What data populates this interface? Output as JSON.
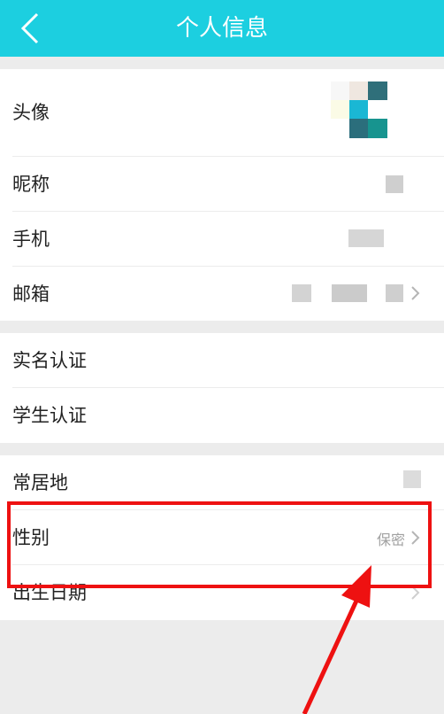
{
  "header": {
    "title": "个人信息",
    "back_icon": "chevron-left-icon",
    "bg_color": "#1ccfe0"
  },
  "profile": {
    "avatar_label": "头像",
    "nickname_label": "昵称",
    "phone_label": "手机",
    "email_label": "邮箱"
  },
  "verification": {
    "real_name_label": "实名认证",
    "student_label": "学生认证"
  },
  "personal": {
    "residence_label": "常居地",
    "gender_label": "性别",
    "gender_value": "保密",
    "birthday_label": "出生日期"
  },
  "annotation": {
    "highlight_color": "#ee1111"
  }
}
